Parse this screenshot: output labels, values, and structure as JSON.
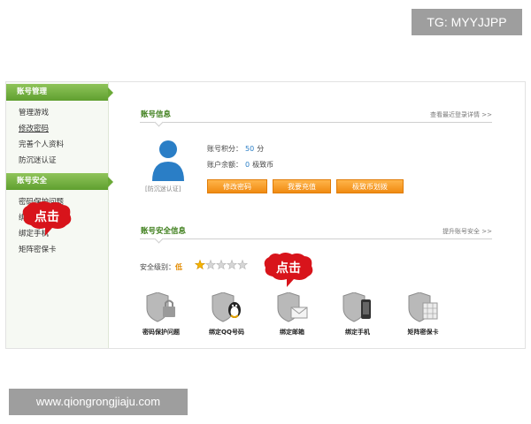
{
  "watermark_top": "TG: MYYJJPP",
  "watermark_bottom": "www.qiongrongjiaju.com",
  "sidebar": {
    "section1_title": "账号管理",
    "section1_items": [
      "管理游戏",
      "修改密码",
      "完善个人资料",
      "防沉迷认证"
    ],
    "section2_title": "账号安全",
    "section2_items": [
      "密码保护问题",
      "绑定邮箱",
      "绑定手机",
      "矩阵密保卡"
    ]
  },
  "callouts": [
    "点击",
    "点击"
  ],
  "account_info": {
    "title": "账号信息",
    "link": "查看最近登录详情 >>",
    "avatar_caption": "[防沉迷认证]",
    "points_label": "账号积分：",
    "points_value": "50",
    "points_unit": "分",
    "balance_label": "账户余额：",
    "balance_value": "0",
    "balance_unit": "极致币",
    "buttons": [
      "修改密码",
      "我要充值",
      "极致币划拨"
    ]
  },
  "security_info": {
    "title": "账号安全信息",
    "link": "提升账号安全 >>",
    "level_label": "安全级别：",
    "level_value": "低",
    "stars_total": 5,
    "stars_filled": 1,
    "items": [
      {
        "label": "密码保护问题",
        "icon": "lock-shield-icon"
      },
      {
        "label": "绑定QQ号码",
        "icon": "qq-shield-icon"
      },
      {
        "label": "绑定邮箱",
        "icon": "mail-shield-icon"
      },
      {
        "label": "绑定手机",
        "icon": "phone-shield-icon"
      },
      {
        "label": "矩阵密保卡",
        "icon": "card-shield-icon"
      }
    ]
  },
  "colors": {
    "accent_green": "#5f9f2f",
    "button_orange": "#f08a12",
    "callout_red": "#d8141b"
  }
}
